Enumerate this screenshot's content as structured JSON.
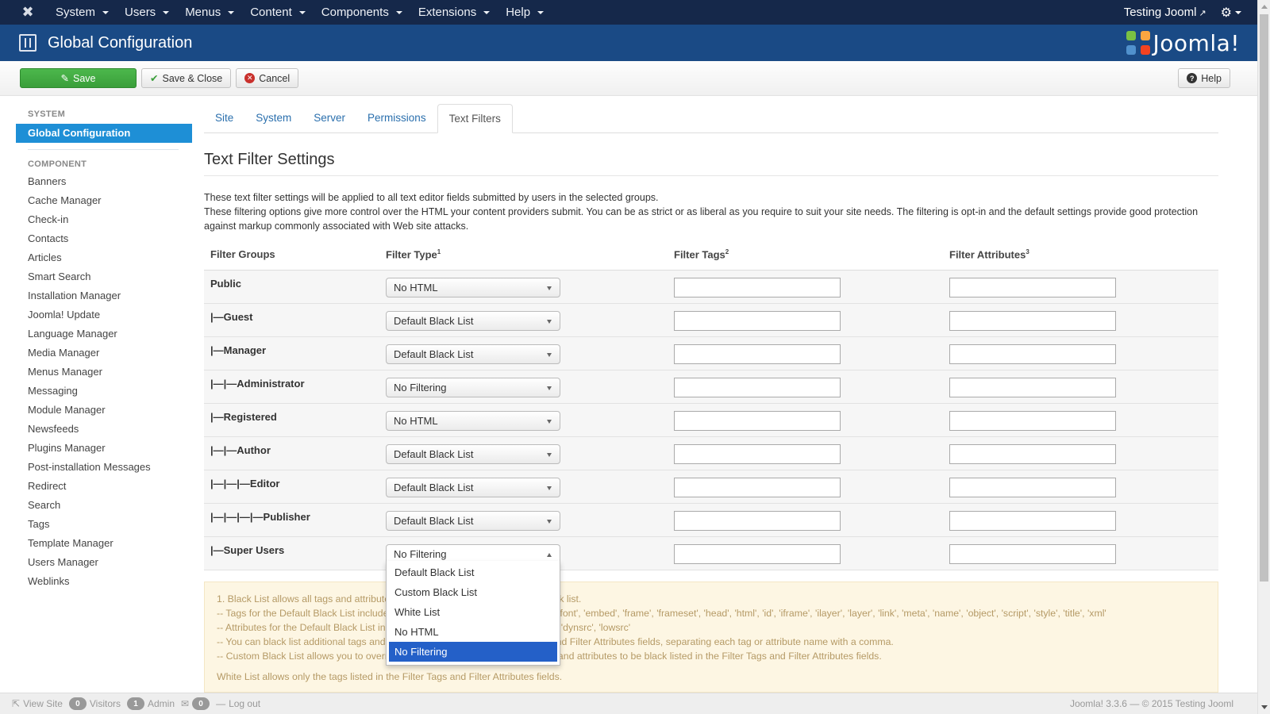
{
  "navbar": {
    "menu": [
      {
        "label": "System"
      },
      {
        "label": "Users"
      },
      {
        "label": "Menus"
      },
      {
        "label": "Content"
      },
      {
        "label": "Components"
      },
      {
        "label": "Extensions"
      },
      {
        "label": "Help"
      }
    ],
    "site_link": "Testing Jooml",
    "logo_icon": "joomla-icon",
    "settings_icon": "gear-icon"
  },
  "subhead": {
    "title": "Global Configuration",
    "brand": "Joomla!"
  },
  "toolbar": {
    "save": "Save",
    "save_close": "Save & Close",
    "cancel": "Cancel",
    "help": "Help"
  },
  "sidebar": {
    "system_heading": "SYSTEM",
    "active_item": "Global Configuration",
    "component_heading": "COMPONENT",
    "items": [
      "Banners",
      "Cache Manager",
      "Check-in",
      "Contacts",
      "Articles",
      "Smart Search",
      "Installation Manager",
      "Joomla! Update",
      "Language Manager",
      "Media Manager",
      "Menus Manager",
      "Messaging",
      "Module Manager",
      "Newsfeeds",
      "Plugins Manager",
      "Post-installation Messages",
      "Redirect",
      "Search",
      "Tags",
      "Template Manager",
      "Users Manager",
      "Weblinks"
    ]
  },
  "tabs": [
    {
      "label": "Site",
      "active": false
    },
    {
      "label": "System",
      "active": false
    },
    {
      "label": "Server",
      "active": false
    },
    {
      "label": "Permissions",
      "active": false
    },
    {
      "label": "Text Filters",
      "active": true
    }
  ],
  "section": {
    "title": "Text Filter Settings",
    "desc_line1": "These text filter settings will be applied to all text editor fields submitted by users in the selected groups.",
    "desc_line2": "These filtering options give more control over the HTML your content providers submit. You can be as strict or as liberal as you require to suit your site needs. The filtering is opt-in and the default settings provide good protection against markup commonly associated with Web site attacks."
  },
  "table": {
    "headers": {
      "groups": "Filter Groups",
      "type": "Filter Type",
      "type_sup": "1",
      "tags": "Filter Tags",
      "tags_sup": "2",
      "attrs": "Filter Attributes",
      "attrs_sup": "3"
    },
    "rows": [
      {
        "group": "Public",
        "filter_type": "No HTML",
        "tags": "",
        "attributes": ""
      },
      {
        "group": "|—Guest",
        "filter_type": "Default Black List",
        "tags": "",
        "attributes": ""
      },
      {
        "group": "|—Manager",
        "filter_type": "Default Black List",
        "tags": "",
        "attributes": ""
      },
      {
        "group": "|—|—Administrator",
        "filter_type": "No Filtering",
        "tags": "",
        "attributes": ""
      },
      {
        "group": "|—Registered",
        "filter_type": "No HTML",
        "tags": "",
        "attributes": ""
      },
      {
        "group": "|—|—Author",
        "filter_type": "Default Black List",
        "tags": "",
        "attributes": ""
      },
      {
        "group": "|—|—|—Editor",
        "filter_type": "Default Black List",
        "tags": "",
        "attributes": ""
      },
      {
        "group": "|—|—|—|—Publisher",
        "filter_type": "Default Black List",
        "tags": "",
        "attributes": ""
      },
      {
        "group": "|—Super Users",
        "filter_type": "No Filtering",
        "tags": "",
        "attributes": ""
      }
    ]
  },
  "dropdown": {
    "open_for": "|—Super Users",
    "options": [
      "Default Black List",
      "Custom Black List",
      "White List",
      "No HTML",
      "No Filtering"
    ],
    "highlighted": "No Filtering"
  },
  "notes": {
    "line1": "1. Black List allows all tags and attributes by default except for those in the black list.",
    "line2": "-- Tags for the Default Black List include: 'applet', 'body', 'bgsound', 'base', 'basefont', 'embed', 'frame', 'frameset', 'head', 'html', 'id', 'iframe', 'ilayer', 'layer', 'link', 'meta', 'name', 'object', 'script', 'style', 'title', 'xml'",
    "line3": "-- Attributes for the Default Black List include: 'action', 'background', 'codebase', 'dynsrc', 'lowsrc'",
    "line4": "-- You can black list additional tags and attributes by adding to the Filter Tags and Filter Attributes fields, separating each tag or attribute name with a comma.",
    "line5": "-- Custom Black List allows you to override the Default Black List. Add the tags and attributes to be black listed in the Filter Tags and Filter Attributes fields.",
    "line6": "White List allows only the tags listed in the Filter Tags and Filter Attributes fields."
  },
  "footer": {
    "view_site": "View Site",
    "visitors_count": "0",
    "visitors_label": "Visitors",
    "admin_count": "1",
    "admin_label": "Admin",
    "messages_count": "0",
    "logout": "Log out",
    "copyright": "Joomla! 3.3.6 — © 2015 Testing Jooml"
  },
  "colors": {
    "navbar": "#15284a",
    "subhead": "#1a4a85",
    "save": "#46a546",
    "sidebar_active": "#1e8fd6",
    "dropdown_highlight": "#2460c8",
    "notes_bg": "#fdf6e3"
  }
}
